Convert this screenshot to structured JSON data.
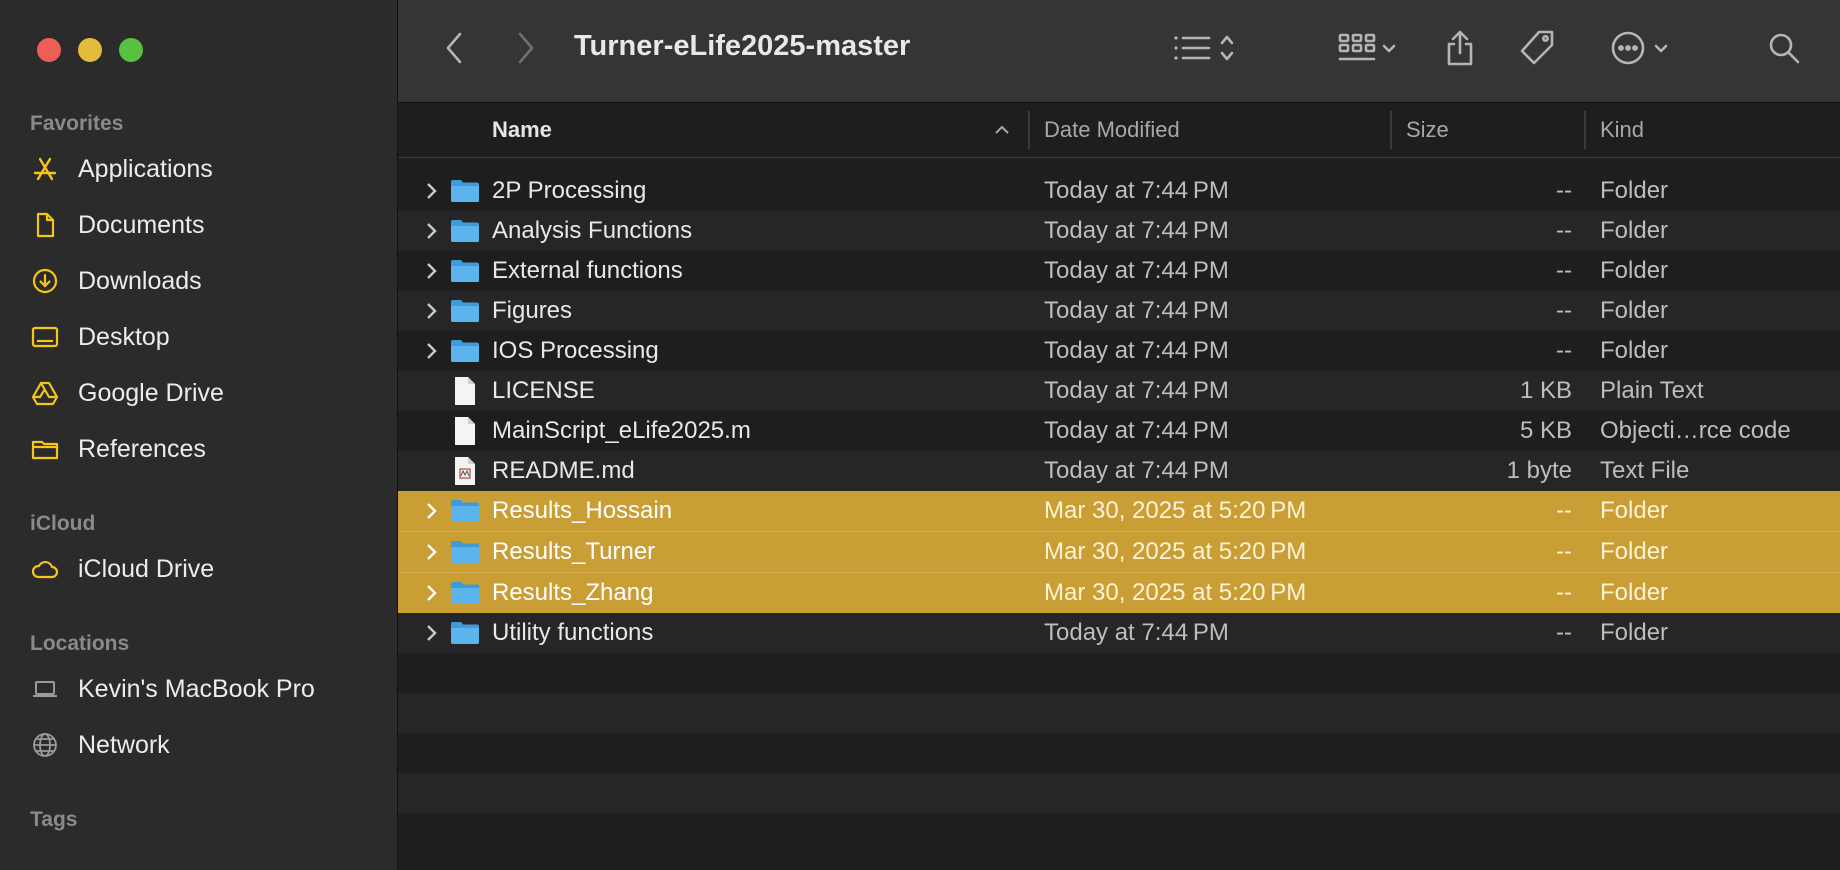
{
  "toolbar": {
    "title": "Turner-eLife2025-master"
  },
  "sidebar": {
    "sections": {
      "favorites": "Favorites",
      "icloud": "iCloud",
      "locations": "Locations",
      "tags": "Tags"
    },
    "favorites": [
      {
        "label": "Applications",
        "icon": "applications-icon"
      },
      {
        "label": "Documents",
        "icon": "document-icon"
      },
      {
        "label": "Downloads",
        "icon": "download-icon"
      },
      {
        "label": "Desktop",
        "icon": "desktop-icon"
      },
      {
        "label": "Google Drive",
        "icon": "google-drive-icon"
      },
      {
        "label": "References",
        "icon": "folder-icon"
      }
    ],
    "icloud": [
      {
        "label": "iCloud Drive",
        "icon": "cloud-icon"
      }
    ],
    "locations": [
      {
        "label": "Kevin's MacBook Pro",
        "icon": "laptop-icon"
      },
      {
        "label": "Network",
        "icon": "globe-icon"
      }
    ],
    "accent_color": "#f5c518"
  },
  "columns": {
    "name": "Name",
    "date": "Date Modified",
    "size": "Size",
    "kind": "Kind"
  },
  "files": [
    {
      "name": "2P Processing",
      "date": "Today at 7:44 PM",
      "size": "--",
      "kind": "Folder",
      "type": "folder",
      "selected": false
    },
    {
      "name": "Analysis Functions",
      "date": "Today at 7:44 PM",
      "size": "--",
      "kind": "Folder",
      "type": "folder",
      "selected": false
    },
    {
      "name": "External functions",
      "date": "Today at 7:44 PM",
      "size": "--",
      "kind": "Folder",
      "type": "folder",
      "selected": false
    },
    {
      "name": "Figures",
      "date": "Today at 7:44 PM",
      "size": "--",
      "kind": "Folder",
      "type": "folder",
      "selected": false
    },
    {
      "name": "IOS Processing",
      "date": "Today at 7:44 PM",
      "size": "--",
      "kind": "Folder",
      "type": "folder",
      "selected": false
    },
    {
      "name": "LICENSE",
      "date": "Today at 7:44 PM",
      "size": "1 KB",
      "kind": "Plain Text",
      "type": "text",
      "selected": false
    },
    {
      "name": "MainScript_eLife2025.m",
      "date": "Today at 7:44 PM",
      "size": "5 KB",
      "kind": "Objecti…rce code",
      "type": "text",
      "selected": false
    },
    {
      "name": "README.md",
      "date": "Today at 7:44 PM",
      "size": "1 byte",
      "kind": "Text File",
      "type": "markdown",
      "selected": false
    },
    {
      "name": "Results_Hossain",
      "date": "Mar 30, 2025 at 5:20 PM",
      "size": "--",
      "kind": "Folder",
      "type": "folder",
      "selected": true
    },
    {
      "name": "Results_Turner",
      "date": "Mar 30, 2025 at 5:20 PM",
      "size": "--",
      "kind": "Folder",
      "type": "folder",
      "selected": true
    },
    {
      "name": "Results_Zhang",
      "date": "Mar 30, 2025 at 5:20 PM",
      "size": "--",
      "kind": "Folder",
      "type": "folder",
      "selected": true
    },
    {
      "name": "Utility functions",
      "date": "Today at 7:44 PM",
      "size": "--",
      "kind": "Folder",
      "type": "folder",
      "selected": false
    }
  ]
}
